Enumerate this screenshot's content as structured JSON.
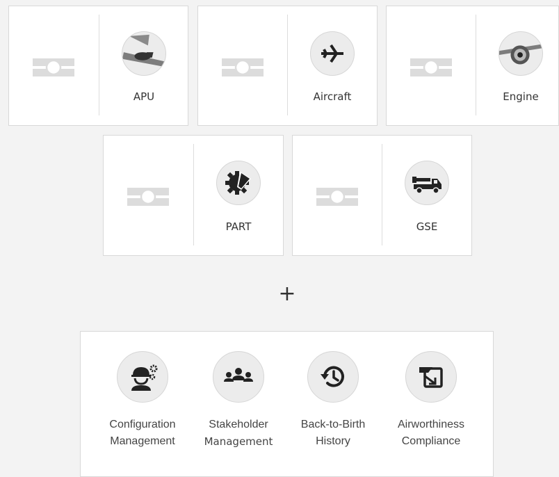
{
  "asset_cards": [
    {
      "label": "APU",
      "icon": "apu-icon"
    },
    {
      "label": "Aircraft",
      "icon": "airplane-icon"
    },
    {
      "label": "Engine",
      "icon": "engine-icon"
    },
    {
      "label": "PART",
      "icon": "part-icon"
    },
    {
      "label": "GSE",
      "icon": "gse-truck-icon"
    }
  ],
  "plus_sign": "+",
  "features": [
    {
      "line1": "Configuration",
      "line2": "Management",
      "icon": "configuration-icon"
    },
    {
      "line1": "Stakeholder",
      "line2": "Management",
      "icon": "stakeholder-icon"
    },
    {
      "line1": "Back-to-Birth",
      "line2": "History",
      "icon": "history-icon"
    },
    {
      "line1": "Airworthiness",
      "line2": "Compliance",
      "icon": "airworthiness-icon"
    }
  ],
  "colors": {
    "chip": "#dcdcdc",
    "icon_fill": "#222222",
    "icon_bg": "#ececec"
  }
}
